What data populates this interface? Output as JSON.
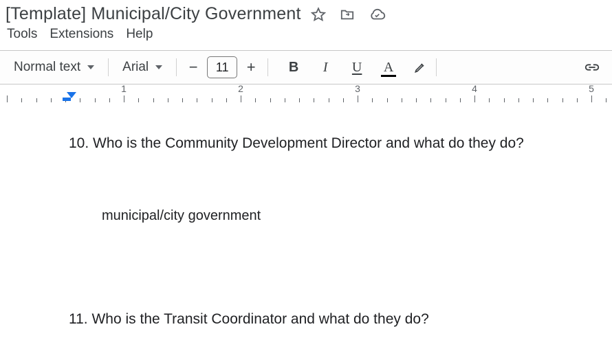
{
  "header": {
    "title": "[Template] Municipal/City Government"
  },
  "menu": {
    "tools": "Tools",
    "extensions": "Extensions",
    "help": "Help"
  },
  "toolbar": {
    "style": "Normal text",
    "font": "Arial",
    "minus": "−",
    "font_size": "11",
    "plus": "+",
    "bold": "B",
    "italic": "I",
    "underline": "U",
    "text_color": "A"
  },
  "ruler": {
    "labels": [
      "1",
      "2",
      "3",
      "4",
      "5"
    ]
  },
  "document": {
    "q10": "10. Who is the Community Development Director and what do they do?",
    "answer": "municipal/city government",
    "q11": "11. Who is the Transit Coordinator and what do they do?"
  }
}
